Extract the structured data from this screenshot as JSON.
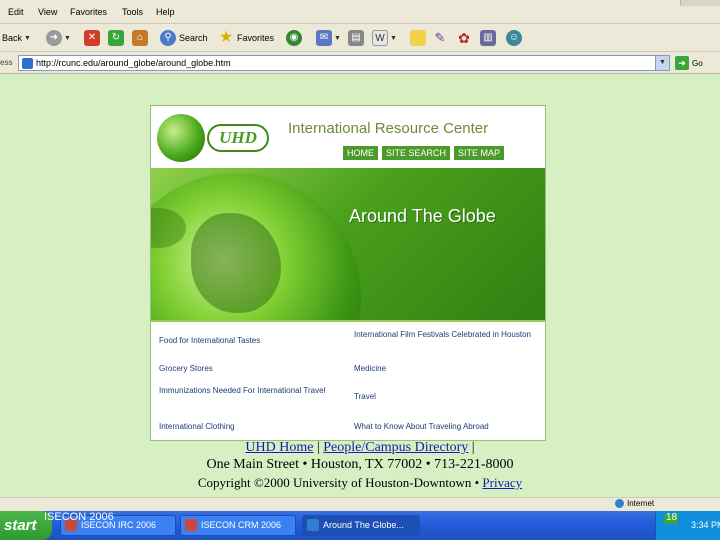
{
  "menu": [
    "Edit",
    "View",
    "Favorites",
    "Tools",
    "Help"
  ],
  "toolbar": {
    "back": "Back",
    "search": "Search",
    "favorites": "Favorites"
  },
  "address": {
    "label": "ess",
    "url": "http://rcunc.edu/around_globe/around_globe.htm",
    "go": "Go"
  },
  "site": {
    "logo": "UHD",
    "title": "International Resource Center",
    "nav": [
      "HOME",
      "SITE SEARCH",
      "SITE MAP"
    ],
    "hero_title": "Around The Globe",
    "links_left": [
      "Food for International Tastes",
      "Grocery Stores",
      "Immunizations Needed For International Travel",
      "International Clothing"
    ],
    "links_right": [
      "International Film Festivals Celebrated in Houston",
      "Medicine",
      "Travel",
      "What to Know About Traveling Abroad"
    ]
  },
  "footer": {
    "link1": "UHD Home",
    "link2": "People/Campus Directory",
    "bar": "|",
    "address": "One Main Street • Houston, TX 77002 • 713-221-8000",
    "copyright": "Copyright ©2000 University of Houston-Downtown • ",
    "privacy": "Privacy"
  },
  "status": {
    "zone": "Internet"
  },
  "taskbar": {
    "start": "start",
    "conference": "ISECON 2006",
    "tasks": [
      "ISECON IRC 2006",
      "ISECON CRM 2006",
      "Around The Globe..."
    ],
    "slide_number": "18",
    "clock": "3:34 PM"
  }
}
